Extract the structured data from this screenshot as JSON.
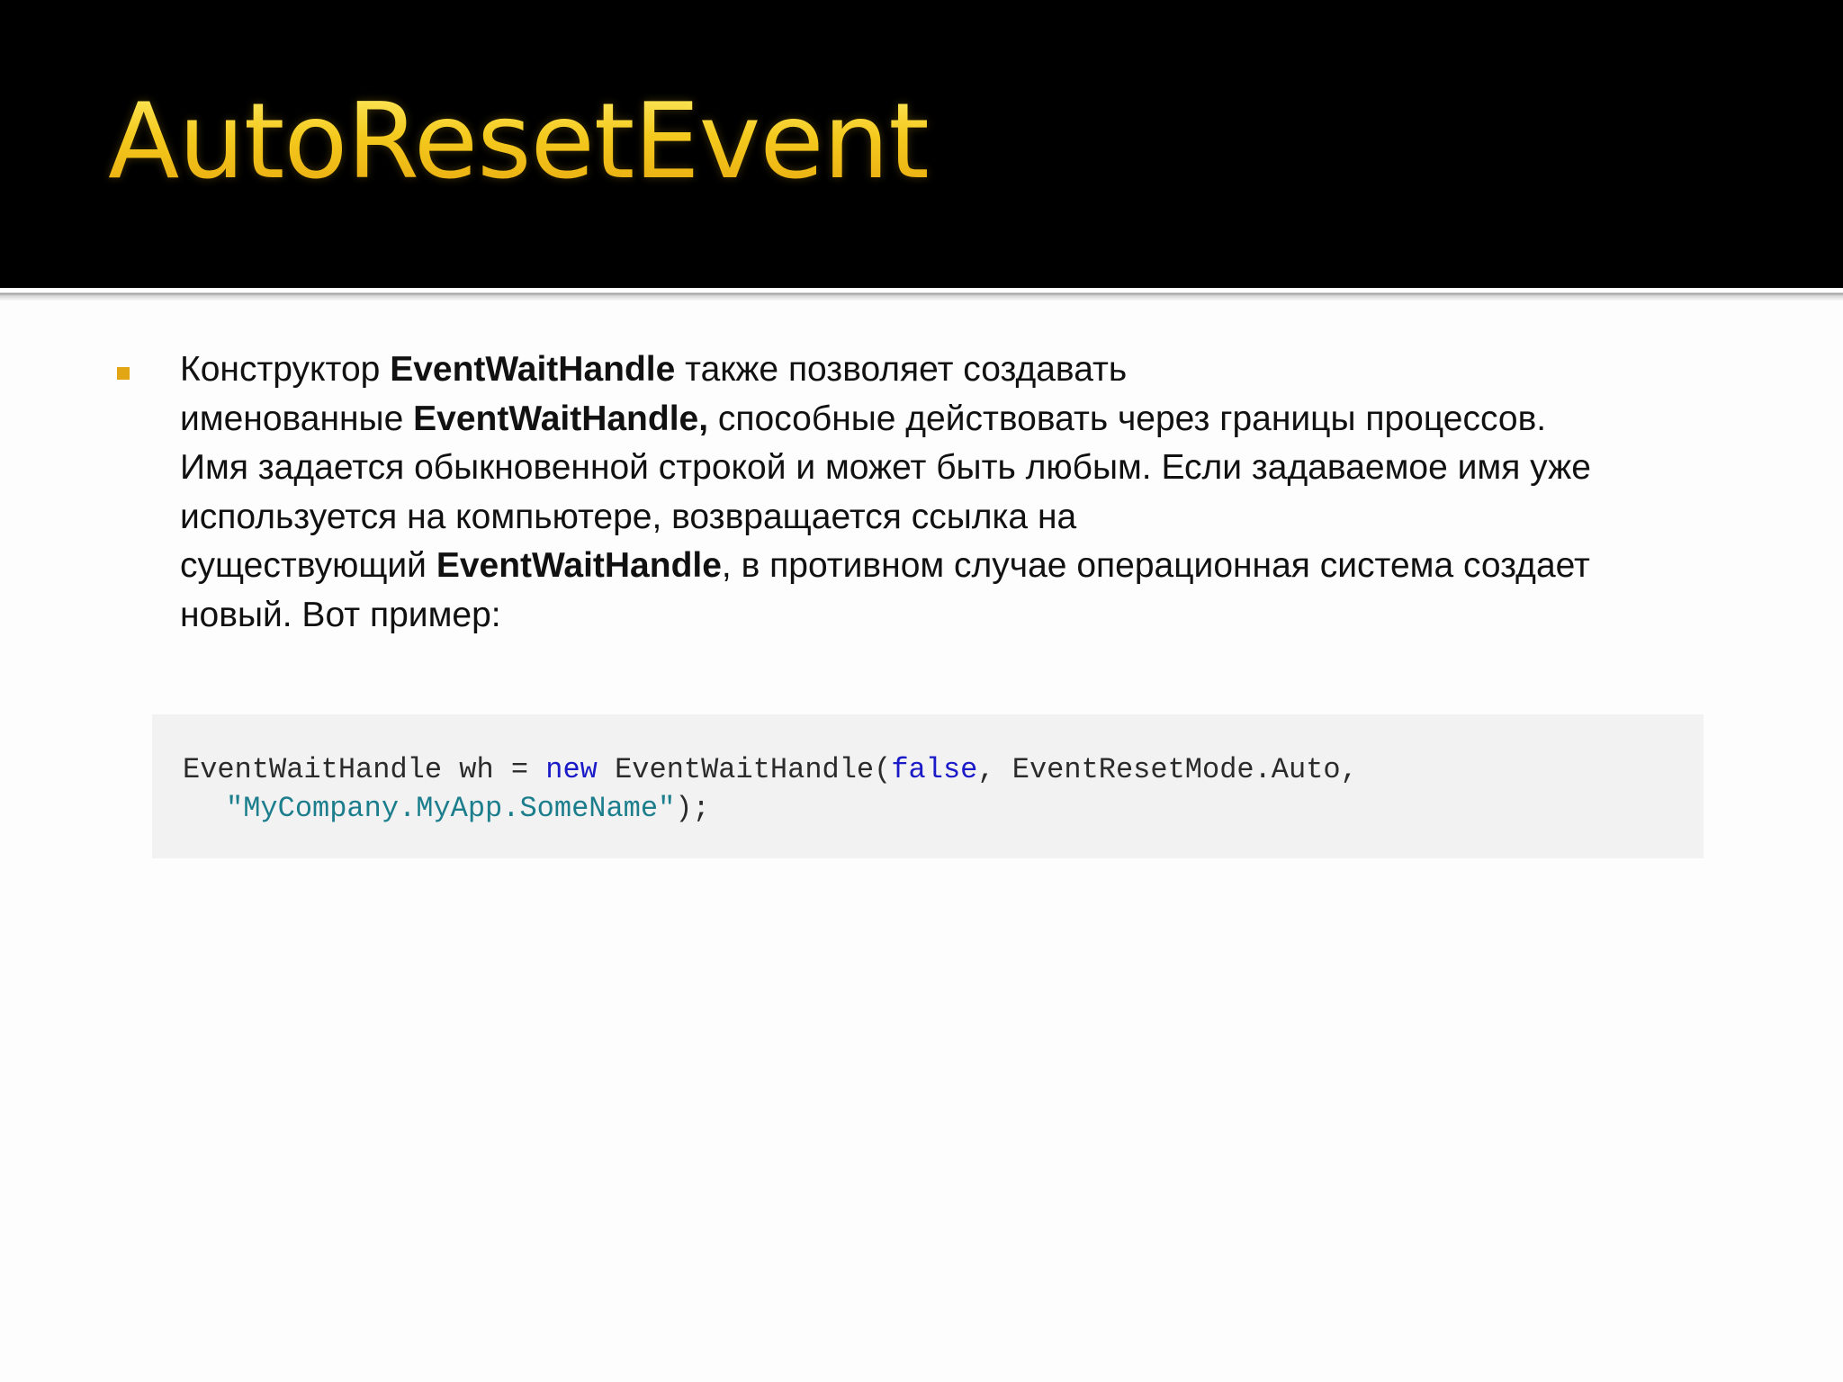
{
  "slide": {
    "title": "AutoResetEvent",
    "body": {
      "s1": "Конструктор ",
      "b1": "EventWaitHandle",
      "s2": " также позволяет создавать",
      "s3": "именованные ",
      "b2": "EventWaitHandle,",
      "s4": " способные действовать через границы процессов.",
      "s5": "Имя задается обыкновенной строкой и может быть любым. Если задаваемое имя уже",
      "s6": "используется на компьютере, возвращается ссылка на",
      "s7": "существующий ",
      "b3": "EventWaitHandle",
      "s8": ", в противном случае операционная система создает",
      "s9": "новый. Вот пример:"
    },
    "code": {
      "t1": "EventWaitHandle wh = ",
      "k1": "new",
      "t2": " EventWaitHandle(",
      "k2": "false",
      "t3": ", EventResetMode.Auto,",
      "s1": "\"MyCompany.MyApp.SomeName\"",
      "t4": ");"
    }
  },
  "colors": {
    "title_band": "#000000",
    "title_text": "#f2c21a",
    "bullet": "#e2a614",
    "code_background": "#f2f2f2",
    "code_keyword": "#1a1ac8",
    "code_string": "#1c7e8c"
  }
}
